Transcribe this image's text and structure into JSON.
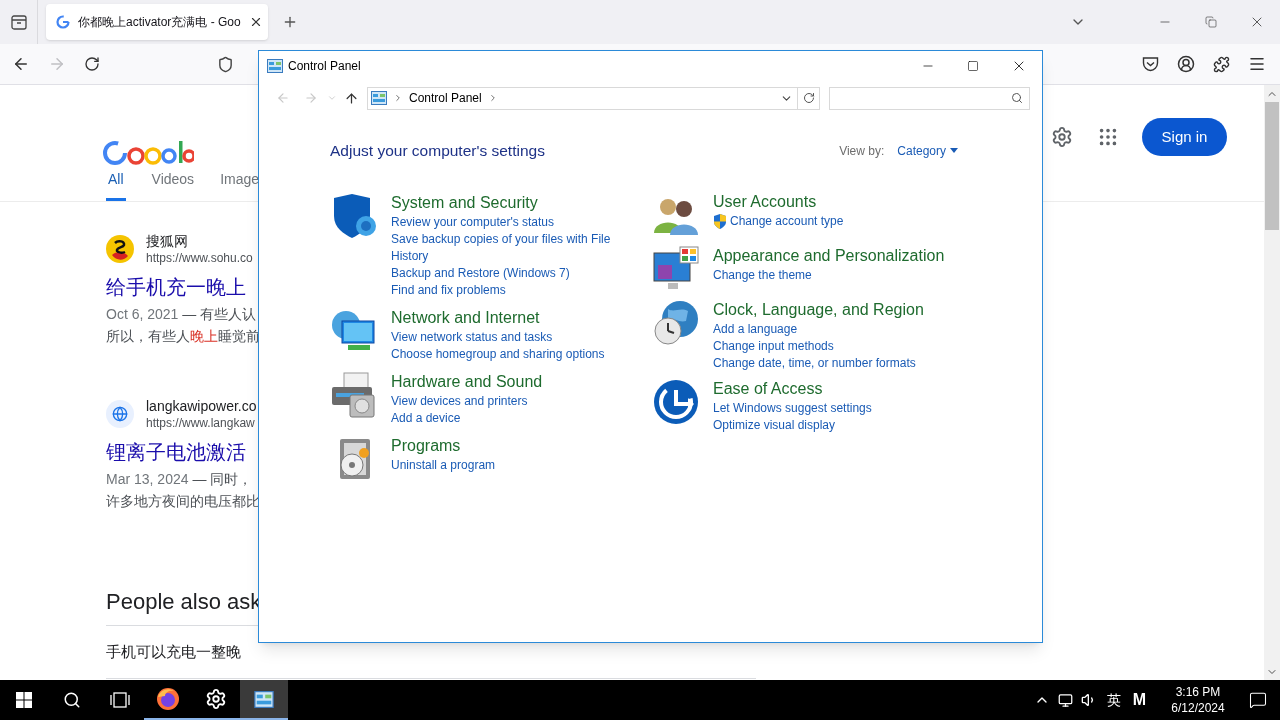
{
  "browser": {
    "tabs": [
      {
        "title": "你都晚上activator充满电 - Goo",
        "selected": true
      }
    ],
    "forward_disabled": true
  },
  "google": {
    "tabs": [
      {
        "label": "All",
        "selected": true
      },
      {
        "label": "Videos",
        "selected": false
      },
      {
        "label": "Image",
        "selected": false
      }
    ],
    "sign_in": "Sign in",
    "results": [
      {
        "kind": "sohu",
        "site": "搜狐网",
        "url": "https://www.sohu.co",
        "title": "给手机充一晚上",
        "date": "Oct 6, 2021",
        "snippet": "— 有些人认",
        "line2": [
          {
            "text": "所以，有些人",
            "highlight": false
          },
          {
            "text": "晚上",
            "highlight": true
          },
          {
            "text": "睡觉前",
            "highlight": false
          }
        ]
      },
      {
        "kind": "globe",
        "site": "langkawipower.co",
        "url": "https://www.langkaw",
        "title": "锂离子电池激活",
        "date": "Mar 13, 2024",
        "snippet": "— 同时，",
        "line2": [
          {
            "text": "许多地方夜间的电压都比",
            "highlight": false
          }
        ]
      }
    ],
    "people_also_ask": {
      "heading": "People also ask",
      "questions": [
        "手机可以充电一整晚"
      ]
    }
  },
  "control_panel": {
    "title": "Control Panel",
    "breadcrumb": [
      "Control Panel"
    ],
    "heading": "Adjust your computer's settings",
    "view_by_label": "View by:",
    "view_by_value": "Category",
    "columns": [
      [
        {
          "kind": "security",
          "title": "System and Security",
          "links": [
            {
              "text": "Review your computer's status",
              "shield": false
            },
            {
              "text": "Save backup copies of your files with File History",
              "shield": false
            },
            {
              "text": "Backup and Restore (Windows 7)",
              "shield": false
            },
            {
              "text": "Find and fix problems",
              "shield": false
            }
          ]
        },
        {
          "kind": "network",
          "title": "Network and Internet",
          "links": [
            {
              "text": "View network status and tasks",
              "shield": false
            },
            {
              "text": "Choose homegroup and sharing options",
              "shield": false
            }
          ]
        },
        {
          "kind": "hardware",
          "title": "Hardware and Sound",
          "links": [
            {
              "text": "View devices and printers",
              "shield": false
            },
            {
              "text": "Add a device",
              "shield": false
            }
          ]
        },
        {
          "kind": "programs",
          "title": "Programs",
          "links": [
            {
              "text": "Uninstall a program",
              "shield": false
            }
          ]
        }
      ],
      [
        {
          "kind": "users",
          "title": "User Accounts",
          "links": [
            {
              "text": "Change account type",
              "shield": true
            }
          ]
        },
        {
          "kind": "appearance",
          "title": "Appearance and Personalization",
          "links": [
            {
              "text": "Change the theme",
              "shield": false
            }
          ]
        },
        {
          "kind": "clock",
          "title": "Clock, Language, and Region",
          "links": [
            {
              "text": "Add a language",
              "shield": false
            },
            {
              "text": "Change input methods",
              "shield": false
            },
            {
              "text": "Change date, time, or number formats",
              "shield": false
            }
          ]
        },
        {
          "kind": "ease",
          "title": "Ease of Access",
          "links": [
            {
              "text": "Let Windows suggest settings",
              "shield": false
            },
            {
              "text": "Optimize visual display",
              "shield": false
            }
          ]
        }
      ]
    ]
  },
  "taskbar": {
    "apps": [
      {
        "kind": "firefox",
        "active": false
      },
      {
        "kind": "settings",
        "active": false
      },
      {
        "kind": "control-panel",
        "active": true
      }
    ],
    "ime": "英",
    "ime_mode": "M",
    "time": "3:16 PM",
    "date": "6/12/2024"
  }
}
